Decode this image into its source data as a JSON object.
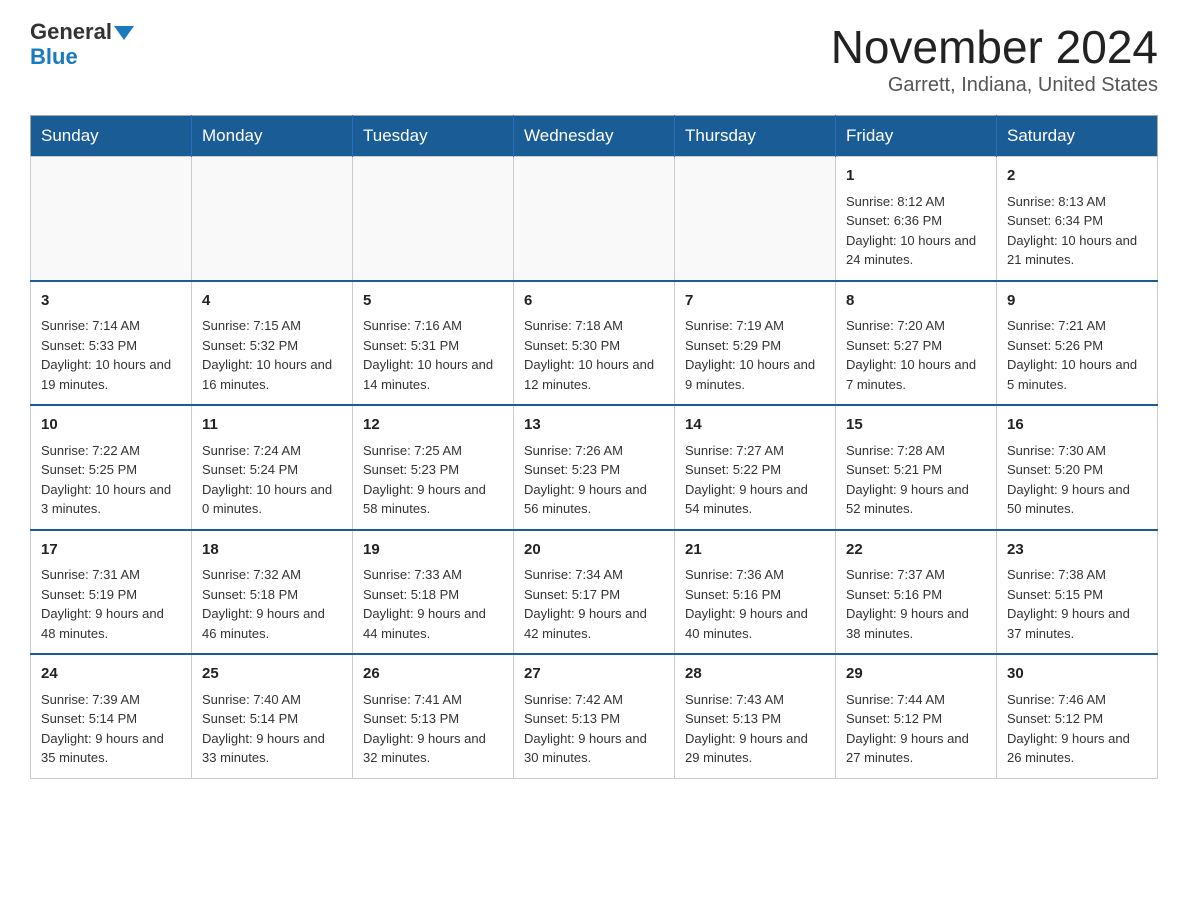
{
  "logo": {
    "general": "General",
    "blue": "Blue"
  },
  "title": "November 2024",
  "location": "Garrett, Indiana, United States",
  "days_of_week": [
    "Sunday",
    "Monday",
    "Tuesday",
    "Wednesday",
    "Thursday",
    "Friday",
    "Saturday"
  ],
  "weeks": [
    [
      {
        "day": "",
        "info": ""
      },
      {
        "day": "",
        "info": ""
      },
      {
        "day": "",
        "info": ""
      },
      {
        "day": "",
        "info": ""
      },
      {
        "day": "",
        "info": ""
      },
      {
        "day": "1",
        "info": "Sunrise: 8:12 AM\nSunset: 6:36 PM\nDaylight: 10 hours and 24 minutes."
      },
      {
        "day": "2",
        "info": "Sunrise: 8:13 AM\nSunset: 6:34 PM\nDaylight: 10 hours and 21 minutes."
      }
    ],
    [
      {
        "day": "3",
        "info": "Sunrise: 7:14 AM\nSunset: 5:33 PM\nDaylight: 10 hours and 19 minutes."
      },
      {
        "day": "4",
        "info": "Sunrise: 7:15 AM\nSunset: 5:32 PM\nDaylight: 10 hours and 16 minutes."
      },
      {
        "day": "5",
        "info": "Sunrise: 7:16 AM\nSunset: 5:31 PM\nDaylight: 10 hours and 14 minutes."
      },
      {
        "day": "6",
        "info": "Sunrise: 7:18 AM\nSunset: 5:30 PM\nDaylight: 10 hours and 12 minutes."
      },
      {
        "day": "7",
        "info": "Sunrise: 7:19 AM\nSunset: 5:29 PM\nDaylight: 10 hours and 9 minutes."
      },
      {
        "day": "8",
        "info": "Sunrise: 7:20 AM\nSunset: 5:27 PM\nDaylight: 10 hours and 7 minutes."
      },
      {
        "day": "9",
        "info": "Sunrise: 7:21 AM\nSunset: 5:26 PM\nDaylight: 10 hours and 5 minutes."
      }
    ],
    [
      {
        "day": "10",
        "info": "Sunrise: 7:22 AM\nSunset: 5:25 PM\nDaylight: 10 hours and 3 minutes."
      },
      {
        "day": "11",
        "info": "Sunrise: 7:24 AM\nSunset: 5:24 PM\nDaylight: 10 hours and 0 minutes."
      },
      {
        "day": "12",
        "info": "Sunrise: 7:25 AM\nSunset: 5:23 PM\nDaylight: 9 hours and 58 minutes."
      },
      {
        "day": "13",
        "info": "Sunrise: 7:26 AM\nSunset: 5:23 PM\nDaylight: 9 hours and 56 minutes."
      },
      {
        "day": "14",
        "info": "Sunrise: 7:27 AM\nSunset: 5:22 PM\nDaylight: 9 hours and 54 minutes."
      },
      {
        "day": "15",
        "info": "Sunrise: 7:28 AM\nSunset: 5:21 PM\nDaylight: 9 hours and 52 minutes."
      },
      {
        "day": "16",
        "info": "Sunrise: 7:30 AM\nSunset: 5:20 PM\nDaylight: 9 hours and 50 minutes."
      }
    ],
    [
      {
        "day": "17",
        "info": "Sunrise: 7:31 AM\nSunset: 5:19 PM\nDaylight: 9 hours and 48 minutes."
      },
      {
        "day": "18",
        "info": "Sunrise: 7:32 AM\nSunset: 5:18 PM\nDaylight: 9 hours and 46 minutes."
      },
      {
        "day": "19",
        "info": "Sunrise: 7:33 AM\nSunset: 5:18 PM\nDaylight: 9 hours and 44 minutes."
      },
      {
        "day": "20",
        "info": "Sunrise: 7:34 AM\nSunset: 5:17 PM\nDaylight: 9 hours and 42 minutes."
      },
      {
        "day": "21",
        "info": "Sunrise: 7:36 AM\nSunset: 5:16 PM\nDaylight: 9 hours and 40 minutes."
      },
      {
        "day": "22",
        "info": "Sunrise: 7:37 AM\nSunset: 5:16 PM\nDaylight: 9 hours and 38 minutes."
      },
      {
        "day": "23",
        "info": "Sunrise: 7:38 AM\nSunset: 5:15 PM\nDaylight: 9 hours and 37 minutes."
      }
    ],
    [
      {
        "day": "24",
        "info": "Sunrise: 7:39 AM\nSunset: 5:14 PM\nDaylight: 9 hours and 35 minutes."
      },
      {
        "day": "25",
        "info": "Sunrise: 7:40 AM\nSunset: 5:14 PM\nDaylight: 9 hours and 33 minutes."
      },
      {
        "day": "26",
        "info": "Sunrise: 7:41 AM\nSunset: 5:13 PM\nDaylight: 9 hours and 32 minutes."
      },
      {
        "day": "27",
        "info": "Sunrise: 7:42 AM\nSunset: 5:13 PM\nDaylight: 9 hours and 30 minutes."
      },
      {
        "day": "28",
        "info": "Sunrise: 7:43 AM\nSunset: 5:13 PM\nDaylight: 9 hours and 29 minutes."
      },
      {
        "day": "29",
        "info": "Sunrise: 7:44 AM\nSunset: 5:12 PM\nDaylight: 9 hours and 27 minutes."
      },
      {
        "day": "30",
        "info": "Sunrise: 7:46 AM\nSunset: 5:12 PM\nDaylight: 9 hours and 26 minutes."
      }
    ]
  ]
}
